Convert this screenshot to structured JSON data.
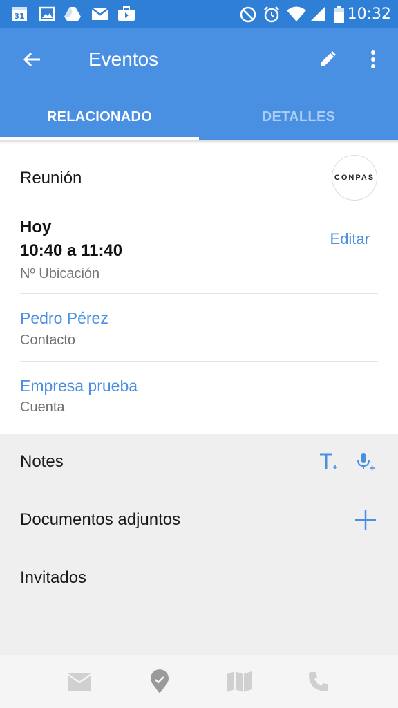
{
  "status_bar": {
    "time": "10:32",
    "calendar_day": "31",
    "icons": [
      "calendar-icon",
      "gallery-icon",
      "drive-icon",
      "gmail-icon",
      "briefcase-icon",
      "do-not-disturb-icon",
      "alarm-icon",
      "wifi-icon",
      "signal-icon",
      "battery-icon"
    ]
  },
  "app_bar": {
    "title": "Eventos",
    "tabs": [
      {
        "label": "RELACIONADO",
        "active": true
      },
      {
        "label": "DETALLES",
        "active": false
      }
    ],
    "colors": {
      "primary": "#4a90e2",
      "status_bar": "#2f7fd6",
      "inactive_tab": "#a9cdf4"
    }
  },
  "event": {
    "title": "Reunión",
    "company_logo_text": "CONPAS",
    "date_label": "Hoy",
    "time_range": "10:40 a 11:40",
    "location": "Nº Ubicación",
    "edit_label": "Editar",
    "contact_name": "Pedro Pérez",
    "contact_type": "Contacto",
    "account_name": "Empresa prueba",
    "account_type": "Cuenta"
  },
  "sections": {
    "notes": "Notes",
    "attachments": "Documentos adjuntos",
    "guests": "Invitados"
  },
  "bottom_nav": {
    "items": [
      "mail-icon",
      "checkin-icon",
      "map-icon",
      "phone-icon"
    ]
  }
}
